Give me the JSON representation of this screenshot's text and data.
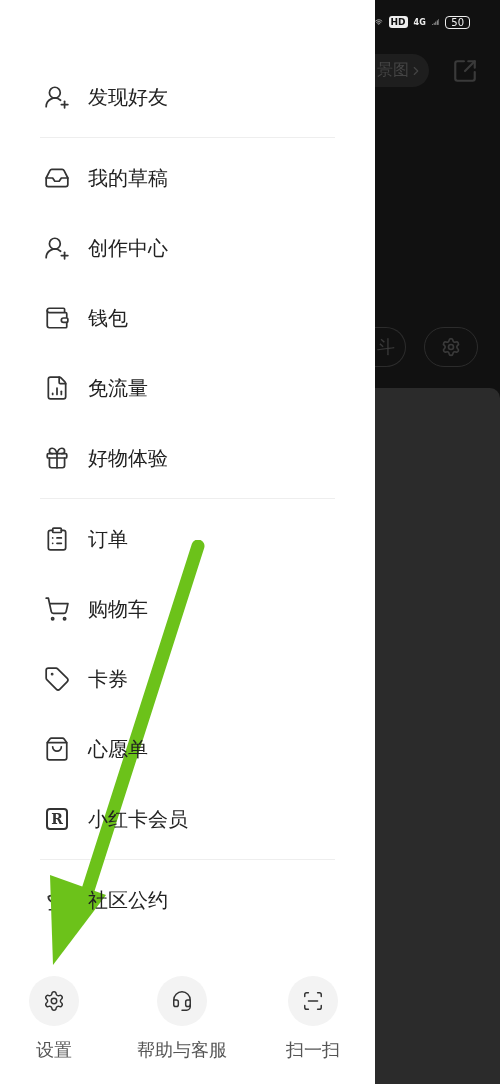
{
  "drawer": {
    "sections": [
      {
        "items": [
          {
            "label": "发现好友"
          }
        ]
      },
      {
        "items": [
          {
            "label": "我的草稿"
          },
          {
            "label": "创作中心"
          },
          {
            "label": "钱包"
          },
          {
            "label": "免流量"
          },
          {
            "label": "好物体验"
          }
        ]
      },
      {
        "items": [
          {
            "label": "订单"
          },
          {
            "label": "购物车"
          },
          {
            "label": "卡券"
          },
          {
            "label": "心愿单"
          },
          {
            "icon_text": "R",
            "label": "小红卡会员"
          }
        ]
      },
      {
        "items": [
          {
            "label": "社区公约"
          }
        ]
      }
    ],
    "actions": [
      {
        "label": "设置"
      },
      {
        "label": "帮助与客服"
      },
      {
        "label": "扫一扫"
      }
    ]
  },
  "status_bar": {
    "hd": "HD",
    "network": "4G",
    "battery": "50"
  },
  "background": {
    "pill_label": "景图",
    "chip_label": "斗"
  }
}
